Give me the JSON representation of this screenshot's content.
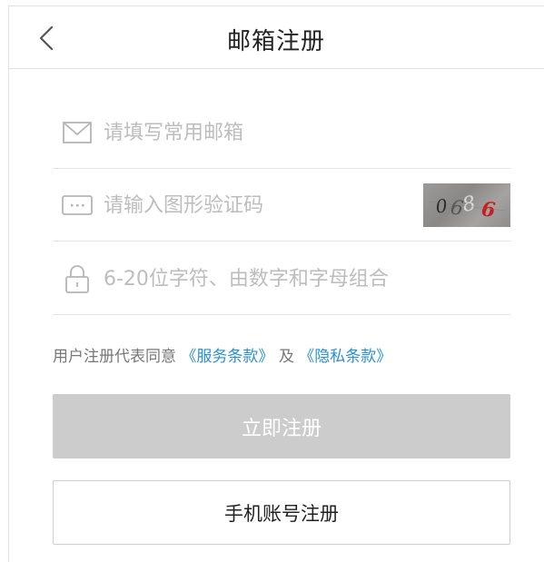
{
  "header": {
    "title": "邮箱注册",
    "back_icon": "chevron-left-icon"
  },
  "form": {
    "email": {
      "placeholder": "请填写常用邮箱",
      "value": "",
      "icon": "envelope-icon"
    },
    "captcha": {
      "placeholder": "请输入图形验证码",
      "value": "",
      "icon": "keyboard-icon",
      "image_text": "0686"
    },
    "password": {
      "placeholder": "6-20位字符、由数字和字母组合",
      "value": "",
      "icon": "lock-icon"
    }
  },
  "agreement": {
    "prefix": "用户注册代表同意",
    "terms_link": "《服务条款》",
    "connector": "及",
    "privacy_link": "《隐私条款》",
    "link_color": "#2a8fd0"
  },
  "buttons": {
    "register": "立即注册",
    "phone_register": "手机账号注册"
  },
  "colors": {
    "disabled_button": "#cccccc",
    "divider": "#e4e4e4",
    "placeholder": "#bdbdbd"
  }
}
